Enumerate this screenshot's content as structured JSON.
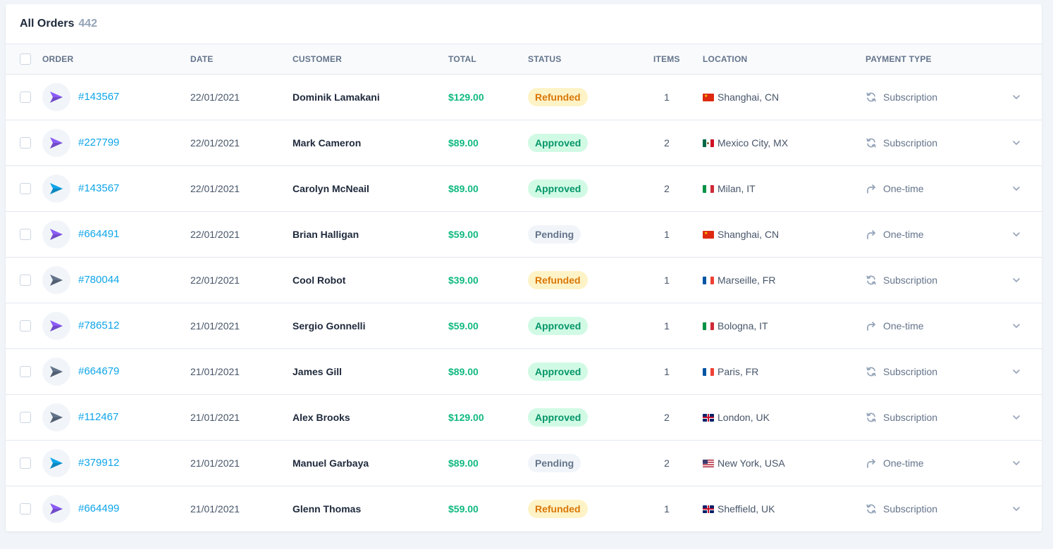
{
  "header": {
    "title": "All Orders",
    "count": "442"
  },
  "columns": {
    "order": "Order",
    "date": "Date",
    "customer": "Customer",
    "total": "Total",
    "status": "Status",
    "items": "Items",
    "location": "Location",
    "payment_type": "Payment Type"
  },
  "colors": {
    "accent": "#0ea5e9",
    "total": "#10b981",
    "refunded_bg": "#fef3c7",
    "refunded_fg": "#d97706",
    "approved_bg": "#d1fae5",
    "approved_fg": "#059669",
    "pending_bg": "#f1f5f9",
    "pending_fg": "#64748b"
  },
  "rows": [
    {
      "order": "#143567",
      "date": "22/01/2021",
      "customer": "Dominik Lamakani",
      "total": "$129.00",
      "status": "Refunded",
      "items": "1",
      "location": "Shanghai, CN",
      "flag": "cn",
      "payment": "Subscription",
      "payment_icon": "refresh-icon",
      "icon_color": "#8b5cf6"
    },
    {
      "order": "#227799",
      "date": "22/01/2021",
      "customer": "Mark Cameron",
      "total": "$89.00",
      "status": "Approved",
      "items": "2",
      "location": "Mexico City, MX",
      "flag": "mx",
      "payment": "Subscription",
      "payment_icon": "refresh-icon",
      "icon_color": "#8b5cf6"
    },
    {
      "order": "#143567",
      "date": "22/01/2021",
      "customer": "Carolyn McNeail",
      "total": "$89.00",
      "status": "Approved",
      "items": "2",
      "location": "Milan, IT",
      "flag": "it",
      "payment": "One-time",
      "payment_icon": "redo-icon",
      "icon_color": "#0ea5e9"
    },
    {
      "order": "#664491",
      "date": "22/01/2021",
      "customer": "Brian Halligan",
      "total": "$59.00",
      "status": "Pending",
      "items": "1",
      "location": "Shanghai, CN",
      "flag": "cn",
      "payment": "One-time",
      "payment_icon": "redo-icon",
      "icon_color": "#8b5cf6"
    },
    {
      "order": "#780044",
      "date": "22/01/2021",
      "customer": "Cool Robot",
      "total": "$39.00",
      "status": "Refunded",
      "items": "1",
      "location": "Marseille, FR",
      "flag": "fr",
      "payment": "Subscription",
      "payment_icon": "refresh-icon",
      "icon_color": "#64748b"
    },
    {
      "order": "#786512",
      "date": "21/01/2021",
      "customer": "Sergio Gonnelli",
      "total": "$59.00",
      "status": "Approved",
      "items": "1",
      "location": "Bologna, IT",
      "flag": "it",
      "payment": "One-time",
      "payment_icon": "redo-icon",
      "icon_color": "#8b5cf6"
    },
    {
      "order": "#664679",
      "date": "21/01/2021",
      "customer": "James Gill",
      "total": "$89.00",
      "status": "Approved",
      "items": "1",
      "location": "Paris, FR",
      "flag": "fr",
      "payment": "Subscription",
      "payment_icon": "refresh-icon",
      "icon_color": "#64748b"
    },
    {
      "order": "#112467",
      "date": "21/01/2021",
      "customer": "Alex Brooks",
      "total": "$129.00",
      "status": "Approved",
      "items": "2",
      "location": "London, UK",
      "flag": "uk",
      "payment": "Subscription",
      "payment_icon": "refresh-icon",
      "icon_color": "#64748b"
    },
    {
      "order": "#379912",
      "date": "21/01/2021",
      "customer": "Manuel Garbaya",
      "total": "$89.00",
      "status": "Pending",
      "items": "2",
      "location": "New York, USA",
      "flag": "us",
      "payment": "One-time",
      "payment_icon": "redo-icon",
      "icon_color": "#0ea5e9"
    },
    {
      "order": "#664499",
      "date": "21/01/2021",
      "customer": "Glenn Thomas",
      "total": "$59.00",
      "status": "Refunded",
      "items": "1",
      "location": "Sheffield, UK",
      "flag": "uk",
      "payment": "Subscription",
      "payment_icon": "refresh-icon",
      "icon_color": "#8b5cf6"
    }
  ]
}
